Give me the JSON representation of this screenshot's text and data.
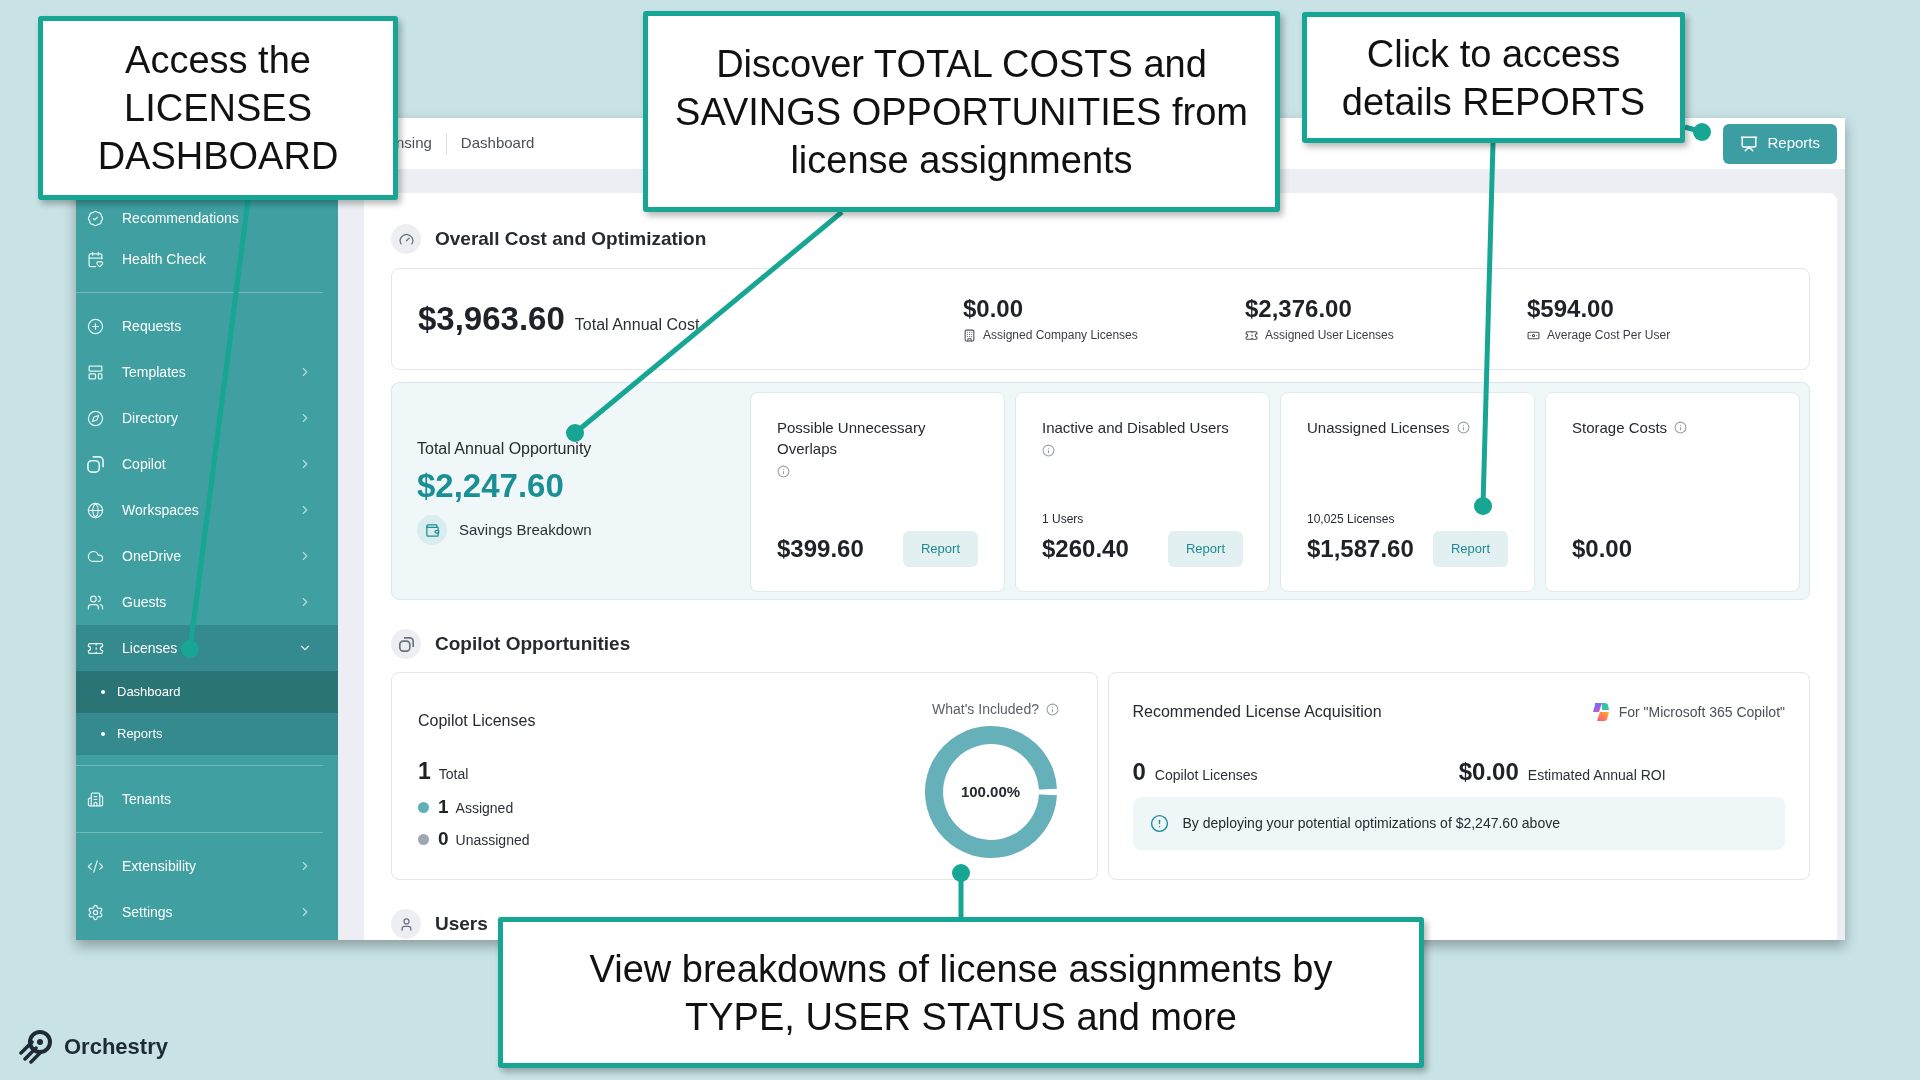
{
  "callouts": [
    {
      "text": "Access the LICENSES DASHBOARD"
    },
    {
      "text": "Discover TOTAL COSTS and SAVINGS OPPORTUNITIES from license assignments"
    },
    {
      "text": "Click to access details REPORTS"
    },
    {
      "text": "View breakdowns of license assignments by TYPE, USER STATUS and more"
    }
  ],
  "app": {
    "breadcrumb": [
      {
        "label": "nsing"
      },
      {
        "label": "Dashboard"
      }
    ],
    "reports_button": "Reports",
    "sidebar": {
      "groups": [
        {
          "items": [
            {
              "label": "Recommendations",
              "selected": false
            },
            {
              "label": "Health Check",
              "selected": false
            }
          ]
        },
        {
          "items": [
            {
              "label": "Requests",
              "selected": false
            },
            {
              "label": "Templates",
              "selected": false,
              "expanded": false
            },
            {
              "label": "Directory",
              "selected": false,
              "expanded": false
            },
            {
              "label": "Copilot",
              "selected": false,
              "expanded": false
            },
            {
              "label": "Workspaces",
              "selected": false,
              "expanded": false
            },
            {
              "label": "OneDrive",
              "selected": false,
              "expanded": false
            },
            {
              "label": "Guests",
              "selected": false,
              "expanded": false
            },
            {
              "label": "Licenses",
              "selected": true,
              "expanded": true,
              "children": [
                {
                  "label": "Dashboard",
                  "selected": true
                },
                {
                  "label": "Reports",
                  "selected": false
                }
              ]
            }
          ]
        },
        {
          "items": [
            {
              "label": "Tenants",
              "selected": false
            }
          ]
        },
        {
          "items": [
            {
              "label": "Extensibility",
              "selected": false,
              "expanded": false
            },
            {
              "label": "Settings",
              "selected": false,
              "expanded": false
            }
          ]
        }
      ]
    },
    "overall": {
      "title": "Overall Cost and Optimization",
      "total": {
        "value": "$3,963.60",
        "label": "Total Annual Cost"
      },
      "stats": [
        {
          "value": "$0.00",
          "label": "Assigned Company Licenses"
        },
        {
          "value": "$2,376.00",
          "label": "Assigned User Licenses"
        },
        {
          "value": "$594.00",
          "label": "Average Cost Per User"
        }
      ]
    },
    "opportunity": {
      "title": "Total Annual Opportunity",
      "value": "$2,247.60",
      "breakdown": "Savings Breakdown",
      "cards": [
        {
          "title": "Possible Unnecessary Overlaps",
          "value": "$399.60",
          "action": "Report"
        },
        {
          "title": "Inactive and Disabled Users",
          "count": "1 Users",
          "value": "$260.40",
          "action": "Report"
        },
        {
          "title": "Unassigned Licenses",
          "count": "10,025 Licenses",
          "value": "$1,587.60",
          "action": "Report"
        },
        {
          "title": "Storage Costs",
          "value": "$0.00"
        }
      ]
    },
    "copilot": {
      "title": "Copilot Opportunities",
      "licenses": {
        "title": "Copilot Licenses",
        "total": {
          "value": "1",
          "label": "Total"
        },
        "legend": [
          {
            "value": "1",
            "label": "Assigned",
            "color": "#5fb0b8"
          },
          {
            "value": "0",
            "label": "Unassigned",
            "color": "#a2a6b2"
          }
        ],
        "whats_included": "What's Included?",
        "ring": {
          "level": 1,
          "reading": "100.00%"
        }
      },
      "acquisition": {
        "title": "Recommended License Acquisition",
        "product": "For \"Microsoft 365 Copilot\"",
        "licenses": {
          "value": "0",
          "label": "Copilot Licenses"
        },
        "roi": {
          "value": "$0.00",
          "label": "Estimated Annual ROI"
        },
        "notice": "By deploying your potential optimizations of $2,247.60 above"
      }
    },
    "users": {
      "title": "Users"
    }
  },
  "brand": {
    "name": "Orchestry"
  }
}
